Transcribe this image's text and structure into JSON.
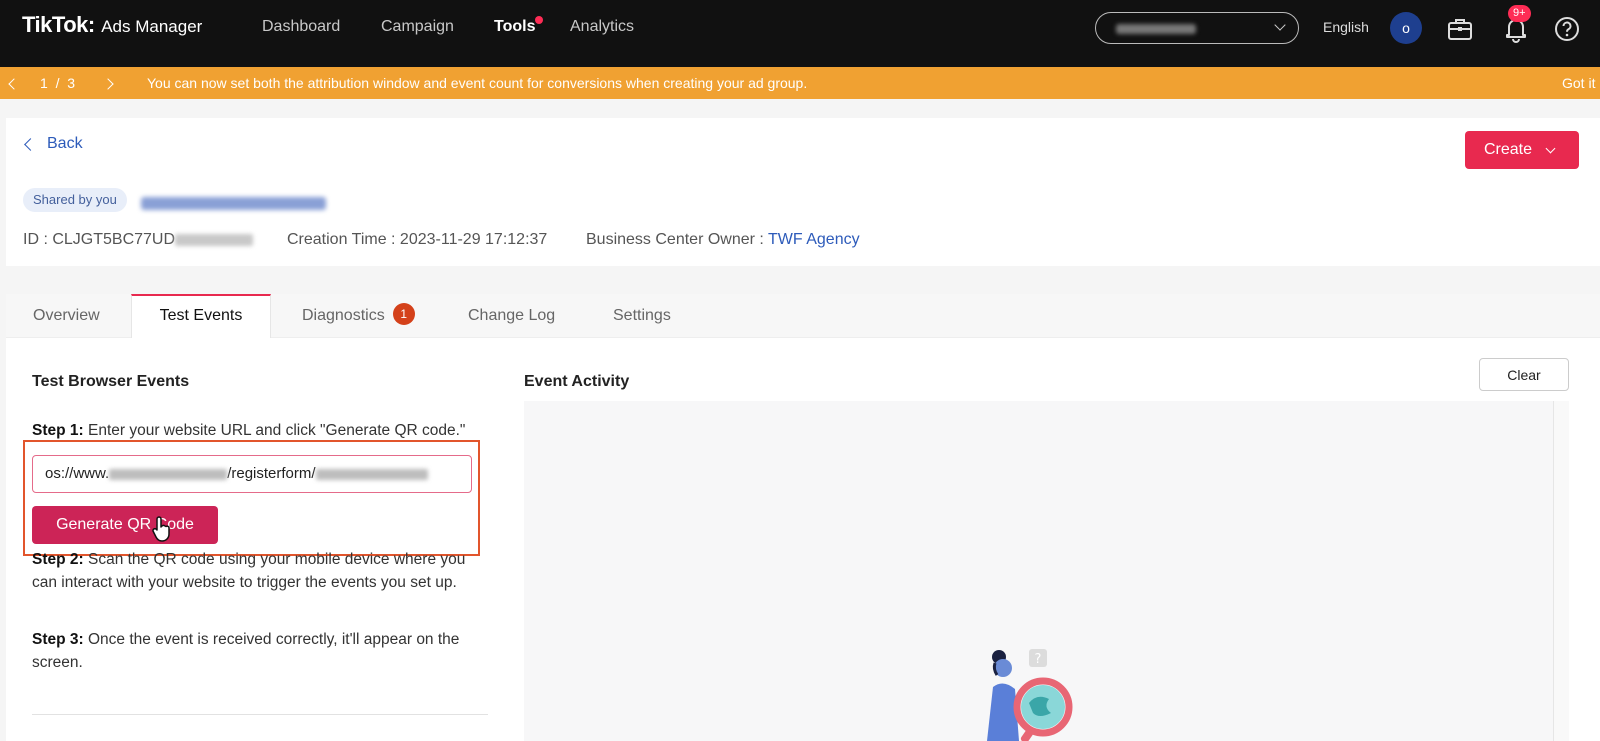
{
  "topnav": {
    "brand": "TikTok",
    "brand_colon": ":",
    "product": "Ads Manager",
    "items": [
      {
        "label": "Dashboard",
        "active": false
      },
      {
        "label": "Campaign",
        "active": false
      },
      {
        "label": "Tools",
        "active": true
      },
      {
        "label": "Analytics",
        "active": false
      }
    ],
    "language": "English",
    "avatar_initial": "o",
    "notification_count": "9+"
  },
  "announcement": {
    "page_current": "1",
    "page_separator": "/",
    "page_total": "3",
    "message": "You can now set both the attribution window and event count for conversions when creating your ad group.",
    "dismiss": "Got it"
  },
  "header": {
    "back_label": "Back",
    "create_label": "Create",
    "shared_tag": "Shared by you",
    "id_label": "ID : CLJGT5BC77UD",
    "creation_time": "Creation Time : 2023-11-29 17:12:37",
    "owner_label": "Business Center Owner : ",
    "owner_name": "TWF Agency"
  },
  "tabs": [
    {
      "label": "Overview"
    },
    {
      "label": "Test Events"
    },
    {
      "label": "Diagnostics",
      "badge": "1"
    },
    {
      "label": "Change Log"
    },
    {
      "label": "Settings"
    }
  ],
  "test_browser": {
    "title": "Test Browser Events",
    "step1_label": "Step 1:",
    "step1_text": " Enter your website URL and click \"Generate QR code.\"",
    "url_prefix": "os://www.",
    "url_middle": "/registerform/",
    "generate_label": "Generate QR Code",
    "step2_label": "Step 2:",
    "step2_text": " Scan the QR code using your mobile device where you can interact with your website to trigger the events you set up.",
    "step3_label": "Step 3:",
    "step3_text": " Once the event is received correctly, it'll appear on the screen."
  },
  "event_activity": {
    "title": "Event Activity",
    "clear_label": "Clear"
  },
  "colors": {
    "brand_red": "#e8294f",
    "announcement": "#f0a132",
    "link_blue": "#2d5bba",
    "highlight_box": "#e2552c"
  }
}
